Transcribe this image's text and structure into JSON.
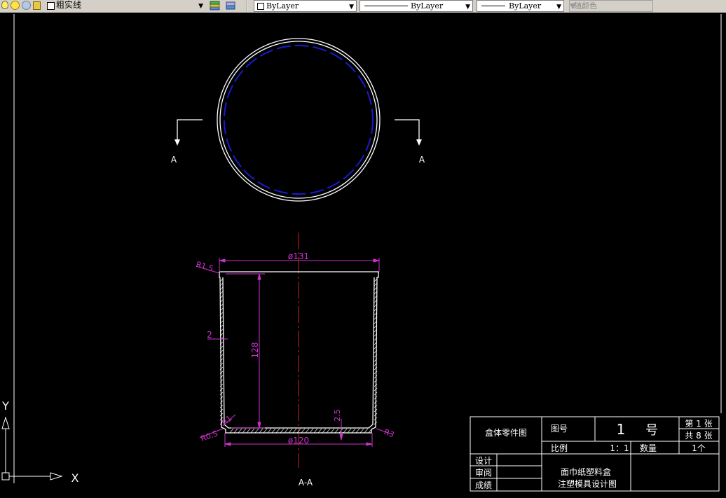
{
  "toolbar": {
    "layer_name": "粗实线",
    "color_combo": "ByLayer",
    "linetype_combo": "ByLayer",
    "lineweight_combo": "ByLayer",
    "plotstyle_combo": "随颜色"
  },
  "drawing": {
    "section_marker_left": "A",
    "section_marker_right": "A",
    "section_view_label": "A-A",
    "dim_outer_dia": "ø131",
    "dim_bottom_dia": "ø120",
    "dim_height": "128",
    "dim_wall": "2",
    "dim_bottom": "2.5",
    "dim_r15": "R1.5",
    "dim_r1": "R1",
    "dim_r05": "R0.5",
    "dim_r3": "R3"
  },
  "ucs": {
    "y": "Y",
    "x": "X"
  },
  "title_block": {
    "part_name": "盒体零件图",
    "drawing_no_label": "图号",
    "drawing_no_value": "1",
    "drawing_no_unit": "号",
    "sheet_no": "第 1 张",
    "sheet_total": "共 8 张",
    "scale_label": "比例",
    "scale_value": "1：1",
    "quantity_label": "数量",
    "quantity_value": "1个",
    "design_label": "设计",
    "review_label": "审阅",
    "grade_label": "成绩",
    "project_title_1": "面巾纸塑料盒",
    "project_title_2": "注塑模具设计图"
  },
  "colors": {
    "background": "#000000",
    "geometry": "#ffffff",
    "dimension": "#cc33cc",
    "centerline": "#cc2222",
    "hidden": "#1a1ad0"
  }
}
